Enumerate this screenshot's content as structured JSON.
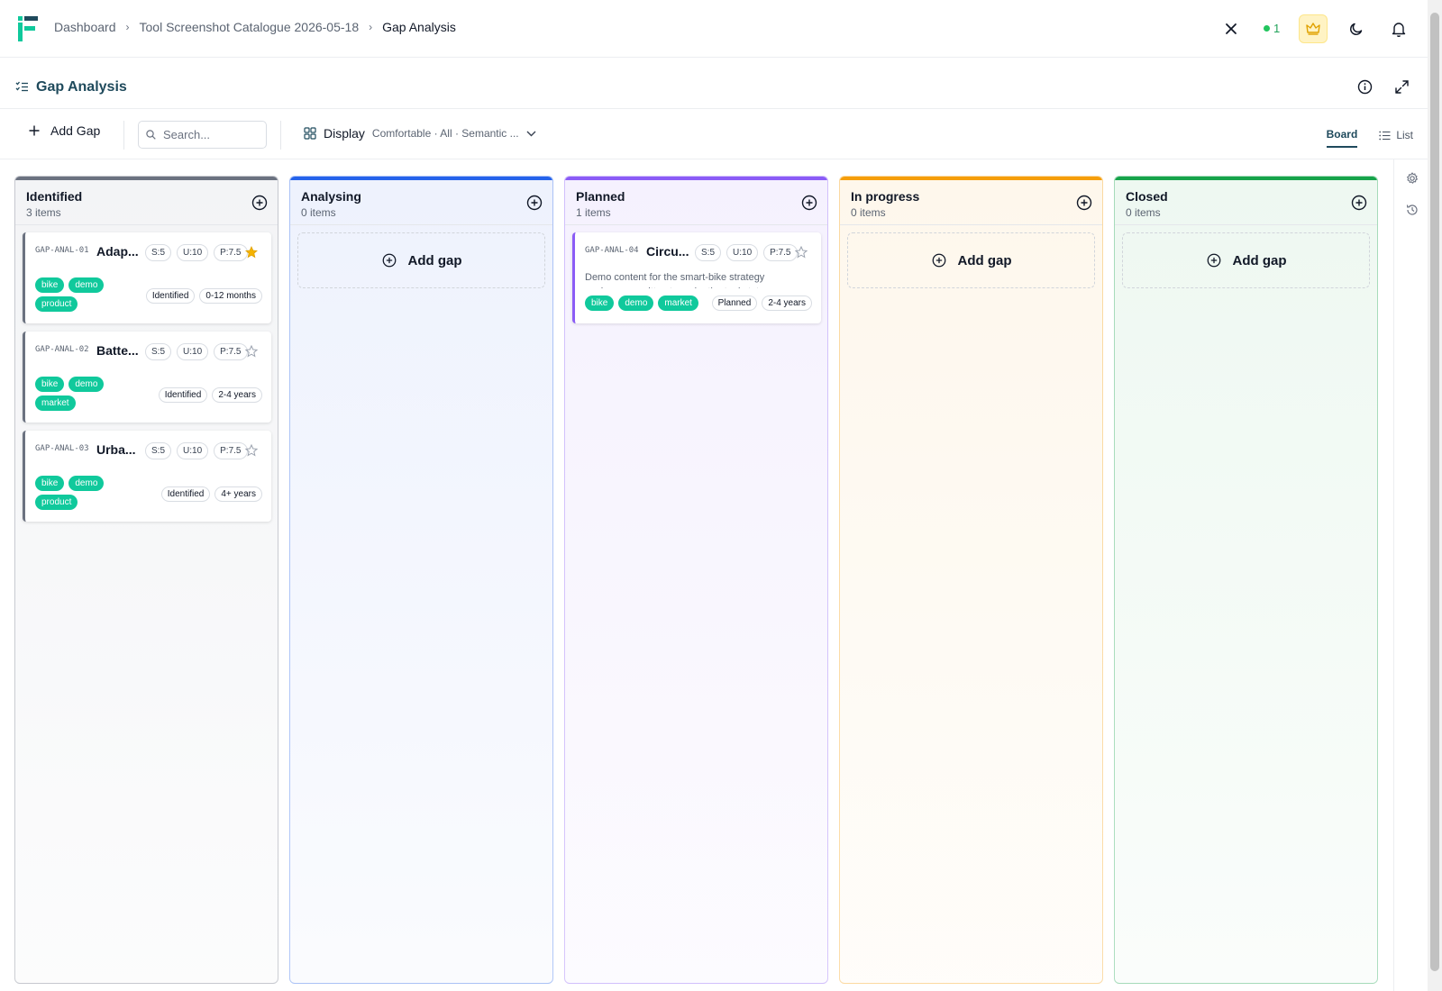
{
  "breadcrumb": {
    "items": [
      "Dashboard",
      "Tool Screenshot Catalogue 2026-05-18",
      "Gap Analysis"
    ]
  },
  "header": {
    "presence_count": "1"
  },
  "page": {
    "title": "Gap Analysis"
  },
  "toolbar": {
    "add_label": "Add Gap",
    "search_placeholder": "Search...",
    "display_label": "Display",
    "display_summary": "Comfortable · All · Semantic ...",
    "view_board": "Board",
    "view_list": "List"
  },
  "columns": [
    {
      "title": "Identified",
      "count": "3 items",
      "color": "#6b7280",
      "bg": "#f3f4f6"
    },
    {
      "title": "Analysing",
      "count": "0 items",
      "color": "#2563eb",
      "bg": "#eef2fd",
      "add_label": "Add gap"
    },
    {
      "title": "Planned",
      "count": "1 items",
      "color": "#8b5cf6",
      "bg": "#f5f1fe"
    },
    {
      "title": "In progress",
      "count": "0 items",
      "color": "#f59e0b",
      "bg": "#fef7ec",
      "add_label": "Add gap"
    },
    {
      "title": "Closed",
      "count": "0 items",
      "color": "#16a34a",
      "bg": "#eef8f1",
      "add_label": "Add gap"
    }
  ],
  "cards": [
    {
      "id": "GAP-ANAL-01",
      "title": "Adap...",
      "s": "S:5",
      "u": "U:10",
      "p": "P:7.5",
      "starred": true,
      "tags": [
        "bike",
        "demo",
        "product"
      ],
      "status": "Identified",
      "horizon": "0-12 months"
    },
    {
      "id": "GAP-ANAL-02",
      "title": "Batte...",
      "s": "S:5",
      "u": "U:10",
      "p": "P:7.5",
      "starred": false,
      "tags": [
        "bike",
        "demo",
        "market"
      ],
      "status": "Identified",
      "horizon": "2-4 years"
    },
    {
      "id": "GAP-ANAL-03",
      "title": "Urba...",
      "s": "S:5",
      "u": "U:10",
      "p": "P:7.5",
      "starred": false,
      "tags": [
        "bike",
        "demo",
        "product"
      ],
      "status": "Identified",
      "horizon": "4+ years"
    },
    {
      "id": "GAP-ANAL-04",
      "title": "Circu...",
      "s": "S:5",
      "u": "U:10",
      "p": "P:7.5",
      "starred": false,
      "description": "Demo content for the smart-bike strategy workspace, written to make the tool state",
      "tags": [
        "bike",
        "demo",
        "market"
      ],
      "status": "Planned",
      "horizon": "2-4 years"
    }
  ],
  "colors": {
    "brand": "#10c99c",
    "title": "#1f4a5c",
    "star": "#f5b301"
  }
}
